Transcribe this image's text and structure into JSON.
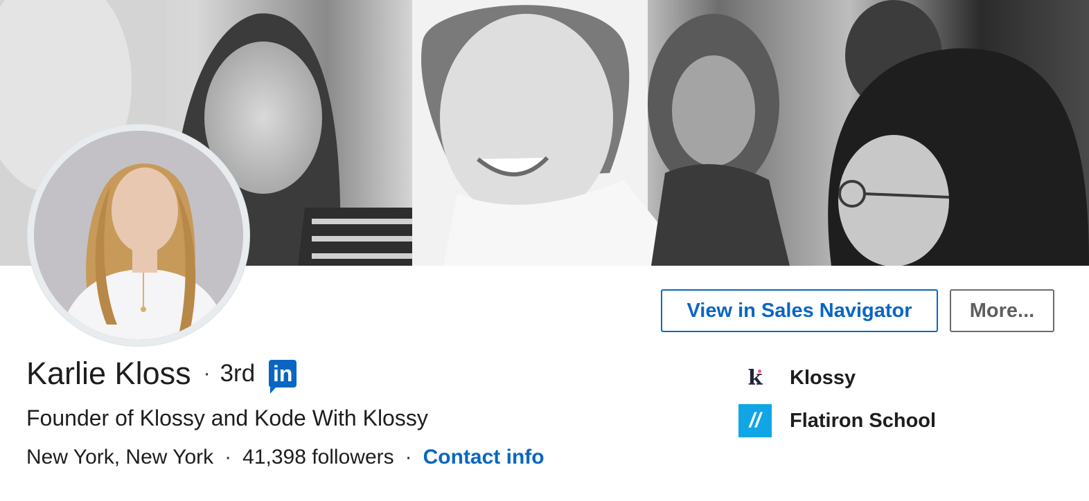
{
  "profile": {
    "name": "Karlie Kloss",
    "separator": "·",
    "degree": "3rd",
    "premium_badge": "in",
    "headline": "Founder of Klossy and Kode With Klossy",
    "location": "New York, New York",
    "followers": "41,398 followers",
    "contact_label": "Contact info"
  },
  "actions": {
    "primary_label": "View in Sales Navigator",
    "more_label": "More..."
  },
  "companies": [
    {
      "name": "Klossy",
      "logo_text": "k"
    },
    {
      "name": "Flatiron School",
      "logo_text": "//"
    }
  ],
  "colors": {
    "accent": "#0a66c2",
    "flatiron": "#10a6e6",
    "klossy_dot": "#e85a8b"
  },
  "icons": {
    "banner": "banner-photo",
    "avatar": "profile-photo",
    "premium": "linkedin-icon"
  }
}
